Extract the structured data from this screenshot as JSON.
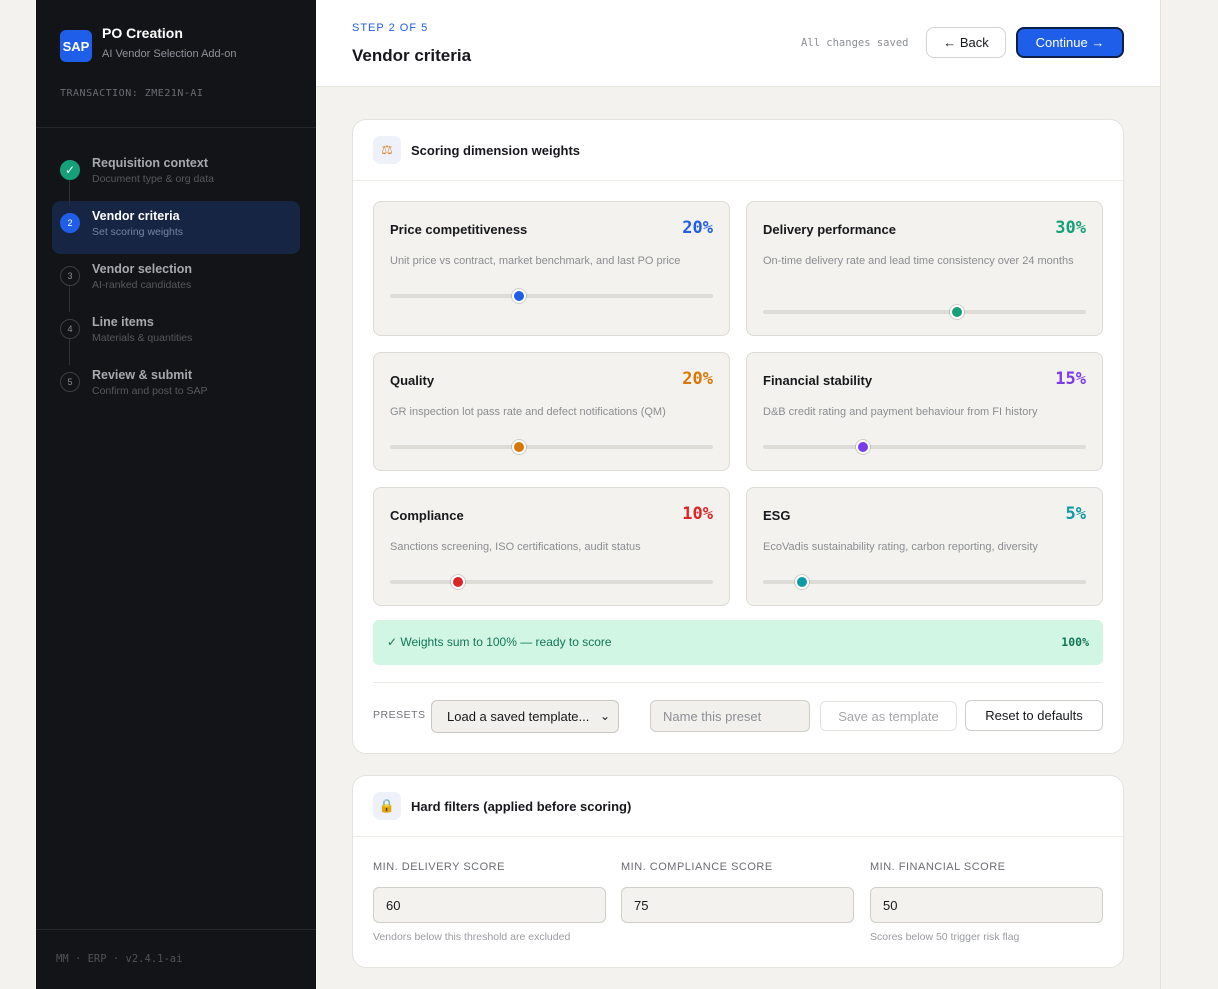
{
  "app": {
    "title": "PO Creation",
    "subtitle": "AI Vendor Selection Add-on",
    "logo": "SAP",
    "transaction": "TRANSACTION: ZME21N-AI",
    "footer": "MM · ERP · v2.4.1-ai"
  },
  "steps": [
    {
      "num": "✓",
      "title": "Requisition context",
      "sub": "Document type & org data",
      "state": "done"
    },
    {
      "num": "2",
      "title": "Vendor criteria",
      "sub": "Set scoring weights",
      "state": "active"
    },
    {
      "num": "3",
      "title": "Vendor selection",
      "sub": "AI-ranked candidates",
      "state": "pending"
    },
    {
      "num": "4",
      "title": "Line items",
      "sub": "Materials & quantities",
      "state": "pending"
    },
    {
      "num": "5",
      "title": "Review & submit",
      "sub": "Confirm and post to SAP",
      "state": "pending"
    }
  ],
  "header": {
    "step_label": "STEP 2 OF 5",
    "title": "Vendor criteria",
    "saved": "All changes saved",
    "back_label": "← Back",
    "continue_label": "Continue →"
  },
  "weights": {
    "title": "Scoring dimension weights",
    "icon": "scale-icon",
    "dimensions": [
      {
        "name": "Price competitiveness",
        "pct": "20%",
        "value": 0.4,
        "color": "#1f5ee8",
        "desc": "Unit price vs contract, market benchmark, and last PO price"
      },
      {
        "name": "Delivery performance",
        "pct": "30%",
        "value": 0.6,
        "color": "#16a07a",
        "desc": "On-time delivery rate and lead time consistency over 24 months"
      },
      {
        "name": "Quality",
        "pct": "20%",
        "value": 0.4,
        "color": "#d97706",
        "desc": "GR inspection lot pass rate and defect notifications (QM)"
      },
      {
        "name": "Financial stability",
        "pct": "15%",
        "value": 0.31,
        "color": "#7c3aed",
        "desc": "D&B credit rating and payment behaviour from FI history"
      },
      {
        "name": "Compliance",
        "pct": "10%",
        "value": 0.21,
        "color": "#dc2626",
        "desc": "Sanctions screening, ISO certifications, audit status"
      },
      {
        "name": "ESG",
        "pct": "5%",
        "value": 0.12,
        "color": "#0e9aa7",
        "desc": "EcoVadis sustainability rating, carbon reporting, diversity"
      }
    ],
    "banner_text": "✓ Weights sum to 100% — ready to score",
    "banner_pct": "100%",
    "presets_label": "PRESETS",
    "preset_select": "Load a saved template...",
    "preset_placeholder": "Name this preset",
    "save_template_label": "Save as template",
    "reset_label": "Reset to defaults"
  },
  "filters": {
    "title": "Hard filters (applied before scoring)",
    "icon": "lock-icon",
    "items": [
      {
        "label": "MIN. DELIVERY SCORE",
        "value": "60",
        "help": "Vendors below this threshold are excluded"
      },
      {
        "label": "MIN. COMPLIANCE SCORE",
        "value": "75",
        "help": ""
      },
      {
        "label": "MIN. FINANCIAL SCORE",
        "value": "50",
        "help": "Scores below 50 trigger risk flag"
      }
    ]
  }
}
